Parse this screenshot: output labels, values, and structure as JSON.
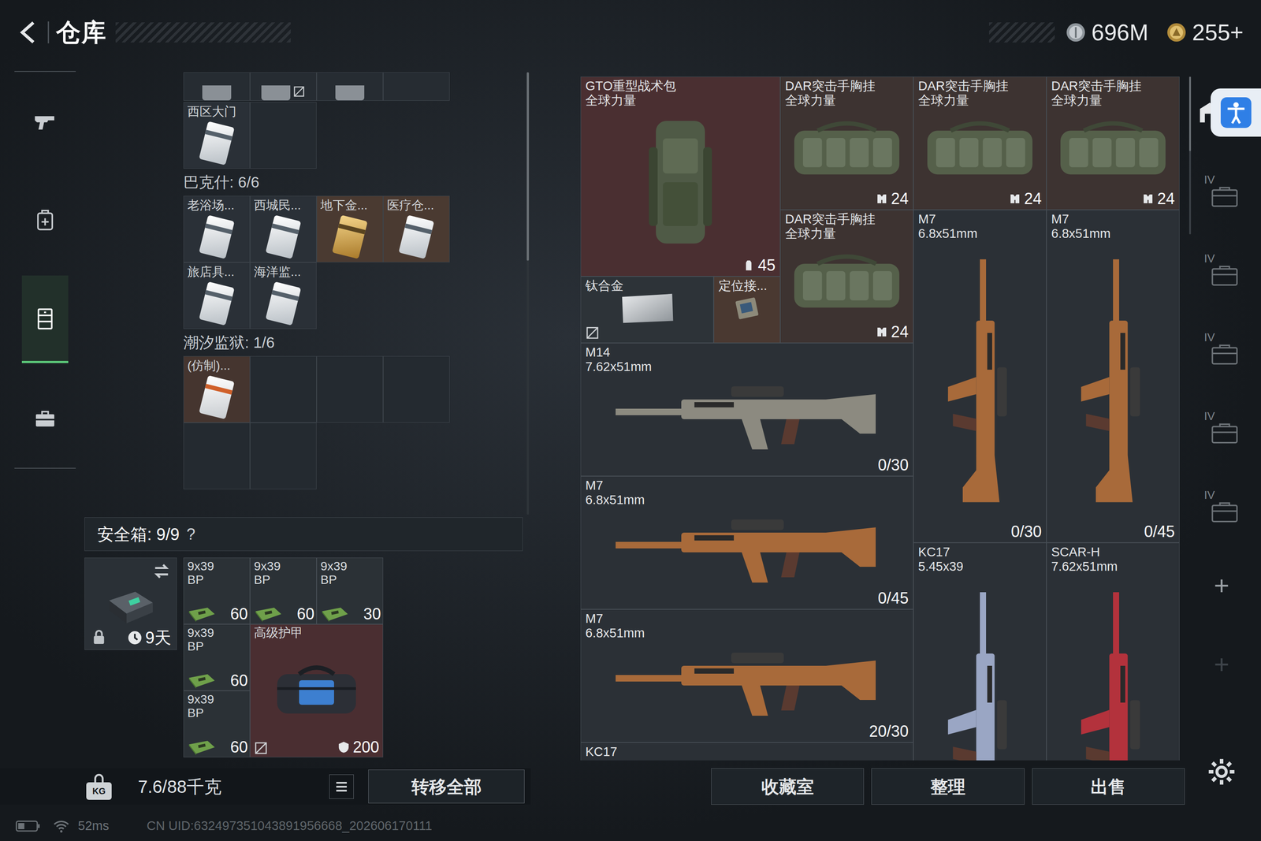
{
  "header": {
    "title": "仓库",
    "currencies": [
      {
        "value": "696M",
        "kind": "coin"
      },
      {
        "value": "255+",
        "kind": "bond"
      }
    ]
  },
  "nav": [
    {
      "kind": "weapons",
      "selected": false
    },
    {
      "kind": "loadout",
      "selected": false
    },
    {
      "kind": "storage",
      "selected": true
    },
    {
      "kind": "trade",
      "selected": false
    }
  ],
  "keycards": {
    "groups": [
      {
        "slots": 2,
        "cards": [
          {
            "label": "西区大门",
            "color": "#2a3037",
            "kind": "standard"
          }
        ]
      },
      {
        "title": "巴克什: 6/6",
        "slots": 6,
        "cards": [
          {
            "label": "老浴场...",
            "color": "#2a3037",
            "kind": "standard"
          },
          {
            "label": "西城民...",
            "color": "#2a3037",
            "kind": "standard"
          },
          {
            "label": "地下金...",
            "color": "#4a3a31",
            "kind": "gold"
          },
          {
            "label": "医疗仓...",
            "color": "#4a3a31",
            "kind": "standard"
          },
          {
            "label": "旅店具...",
            "color": "#2a3037",
            "kind": "standard"
          },
          {
            "label": "海洋监...",
            "color": "#2a3037",
            "kind": "standard"
          }
        ]
      },
      {
        "title": "潮汐监狱: 1/6",
        "slots": 6,
        "cards": [
          {
            "label": "(仿制)...",
            "color": "#45352f",
            "kind": "replica"
          }
        ]
      }
    ]
  },
  "safe_box": {
    "title": "安全箱: 9/9",
    "help": "?",
    "timer": "9天",
    "locked": true,
    "items": [
      {
        "name": "9x39",
        "sub": "BP",
        "count": "60",
        "kind": "ammo",
        "color": "#2b3136",
        "bound": false
      },
      {
        "name": "9x39",
        "sub": "BP",
        "count": "60",
        "kind": "ammo",
        "color": "#2b3136",
        "bound": false
      },
      {
        "name": "9x39",
        "sub": "BP",
        "count": "30",
        "kind": "ammo",
        "color": "#2b3136",
        "bound": false
      },
      {
        "name": "9x39",
        "sub": "BP",
        "count": "60",
        "kind": "ammo",
        "color": "#2b3136",
        "bound": false
      },
      {
        "name": "高级护甲",
        "count": "200",
        "kind": "armor",
        "color": "#4a2e31",
        "bound": true
      },
      {
        "name": "9x39",
        "sub": "BP",
        "count": "60",
        "kind": "ammo",
        "color": "#2b3136",
        "bound": false
      }
    ]
  },
  "footer_left": {
    "weight_icon_label": "KG",
    "weight": "7.6/88千克",
    "transfer": "转移全部"
  },
  "stash": {
    "items": [
      {
        "name": "GTO重型战术包",
        "sub": "全球力量",
        "count": "45",
        "kind": "backpack",
        "color": "#4a2f31",
        "bound": false
      },
      {
        "name": "DAR突击手胸挂",
        "sub": "全球力量",
        "count": "24",
        "kind": "vest",
        "color": "#3d3331",
        "bound": false
      },
      {
        "name": "DAR突击手胸挂",
        "sub": "全球力量",
        "count": "24",
        "kind": "vest",
        "color": "#3d3331",
        "bound": false
      },
      {
        "name": "DAR突击手胸挂",
        "sub": "全球力量",
        "count": "24",
        "kind": "vest",
        "color": "#3d3331",
        "bound": false
      },
      {
        "name": "DAR突击手胸挂",
        "sub": "全球力量",
        "count": "24",
        "kind": "vest",
        "color": "#3d3331",
        "bound": false
      },
      {
        "name": "钛合金",
        "kind": "plate",
        "color": "#2d3338",
        "bound": true
      },
      {
        "name": "定位接...",
        "kind": "device",
        "color": "#4a3931",
        "bound": false
      },
      {
        "name": "M14",
        "sub": "7.62x51mm",
        "count": "0/30",
        "kind": "rifle",
        "color": "#2b3036",
        "bound": false
      },
      {
        "name": "M7",
        "sub": "6.8x51mm",
        "count": "0/30",
        "kind": "rifle-v",
        "color": "#2b3036",
        "bound": false
      },
      {
        "name": "M7",
        "sub": "6.8x51mm",
        "count": "0/45",
        "kind": "rifle-v",
        "color": "#2b3036",
        "bound": false
      },
      {
        "name": "M7",
        "sub": "6.8x51mm",
        "count": "0/45",
        "kind": "rifle",
        "color": "#2b3036",
        "bound": false
      },
      {
        "name": "KC17",
        "sub": "5.45x39",
        "kind": "rifle-v",
        "color": "#2b3036",
        "bound": false
      },
      {
        "name": "SCAR-H",
        "sub": "7.62x51mm",
        "kind": "rifle-v",
        "color": "#2b3036",
        "bound": false
      },
      {
        "name": "M7",
        "sub": "6.8x51mm",
        "count": "20/30",
        "kind": "rifle",
        "color": "#2b3036",
        "bound": false
      },
      {
        "name": "KC17",
        "kind": "rifle",
        "color": "#2b3036",
        "bound": false
      }
    ]
  },
  "actions": [
    "收藏室",
    "整理",
    "出售"
  ],
  "side_tools": [
    {
      "kind": "cabinet",
      "disabled": false
    },
    {
      "label": "IV",
      "kind": "case",
      "disabled": false
    },
    {
      "label": "IV",
      "kind": "case",
      "disabled": false
    },
    {
      "label": "IV",
      "kind": "case",
      "disabled": false
    },
    {
      "label": "IV",
      "kind": "case",
      "disabled": false
    },
    {
      "label": "IV",
      "kind": "case",
      "disabled": false
    },
    {
      "label": "+",
      "kind": "add",
      "disabled": false
    },
    {
      "label": "+",
      "kind": "add",
      "disabled": true
    }
  ],
  "status_bar": {
    "ping": "52ms",
    "uid": "CN UID:632497351043891956668_202606170111"
  }
}
